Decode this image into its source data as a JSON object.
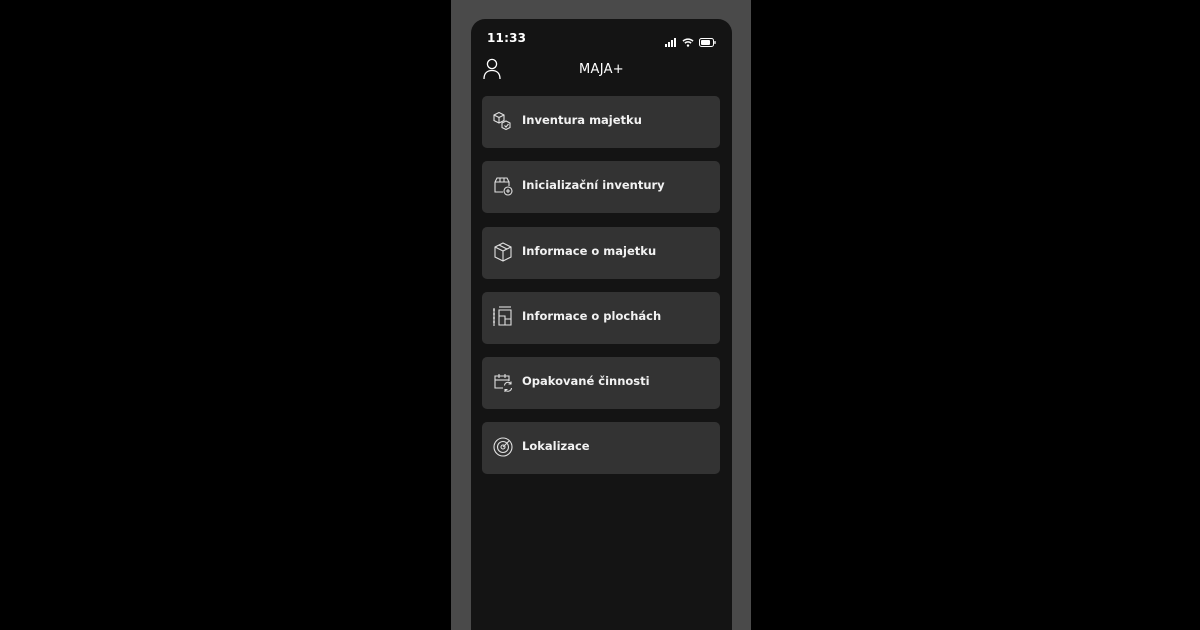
{
  "status_bar": {
    "time": "11:33"
  },
  "header": {
    "title": "MAJA+",
    "profile_icon": "user-icon"
  },
  "menu": {
    "items": [
      {
        "label": "Inventura majetku",
        "icon": "boxes-check-icon"
      },
      {
        "label": "Inicializační inventury",
        "icon": "box-add-icon"
      },
      {
        "label": "Informace o majetku",
        "icon": "cube-icon"
      },
      {
        "label": "Informace o plochách",
        "icon": "floor-plan-icon"
      },
      {
        "label": "Opakované činnosti",
        "icon": "calendar-repeat-icon"
      },
      {
        "label": "Lokalizace",
        "icon": "target-icon"
      }
    ]
  },
  "colors": {
    "background": "#000000",
    "frame": "#4a4a4a",
    "screen": "#141414",
    "card": "#333333",
    "text": "#ffffff"
  }
}
